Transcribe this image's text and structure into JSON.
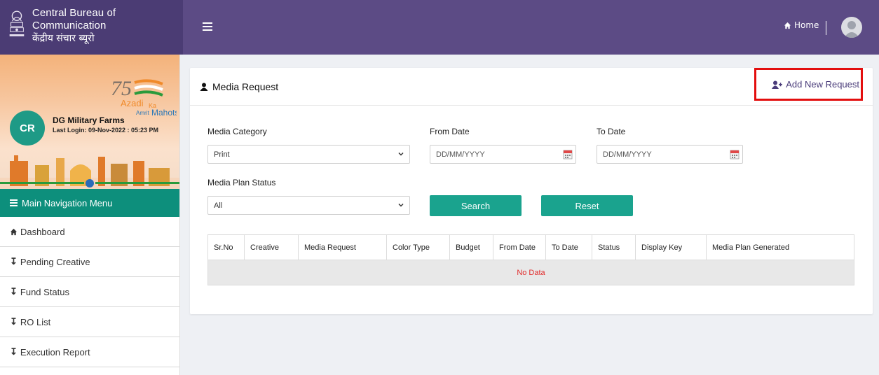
{
  "header": {
    "brand_en": "Central Bureau of Communication",
    "brand_hi": "केंद्रीय संचार ब्यूरो",
    "home_label": "Home"
  },
  "sidebar": {
    "profile": {
      "initials": "CR",
      "name": "DG Military Farms",
      "last_login": "Last Login: 09-Nov-2022 : 05:23 PM",
      "azadi_text": "Azadi Ka Amrit Mahotsav"
    },
    "nav_header": "Main Navigation Menu",
    "items": [
      {
        "label": "Dashboard",
        "icon": "home-icon"
      },
      {
        "label": "Pending Creative",
        "icon": "arrow-down-icon"
      },
      {
        "label": "Fund Status",
        "icon": "arrow-down-icon"
      },
      {
        "label": "RO List",
        "icon": "arrow-down-icon"
      },
      {
        "label": "Execution Report",
        "icon": "arrow-down-icon"
      }
    ]
  },
  "main": {
    "title": "Media Request",
    "add_button": "Add New Request",
    "filters": {
      "media_category_label": "Media Category",
      "media_category_value": "Print",
      "from_date_label": "From Date",
      "from_date_placeholder": "DD/MM/YYYY",
      "to_date_label": "To Date",
      "to_date_placeholder": "DD/MM/YYYY",
      "status_label": "Media Plan Status",
      "status_value": "All"
    },
    "search_button": "Search",
    "reset_button": "Reset",
    "table": {
      "columns": [
        "Sr.No",
        "Creative",
        "Media Request",
        "Color Type",
        "Budget",
        "From Date",
        "To Date",
        "Status",
        "Display Key",
        "Media Plan Generated"
      ],
      "empty_message": "No Data"
    }
  },
  "colors": {
    "topbar": "#5c4b85",
    "brand_bg": "#4b3c74",
    "accent": "#1aa38e",
    "nav_header": "#0d8f7c",
    "highlight_border": "#e30e0e",
    "no_data_text": "#e12b2b"
  }
}
